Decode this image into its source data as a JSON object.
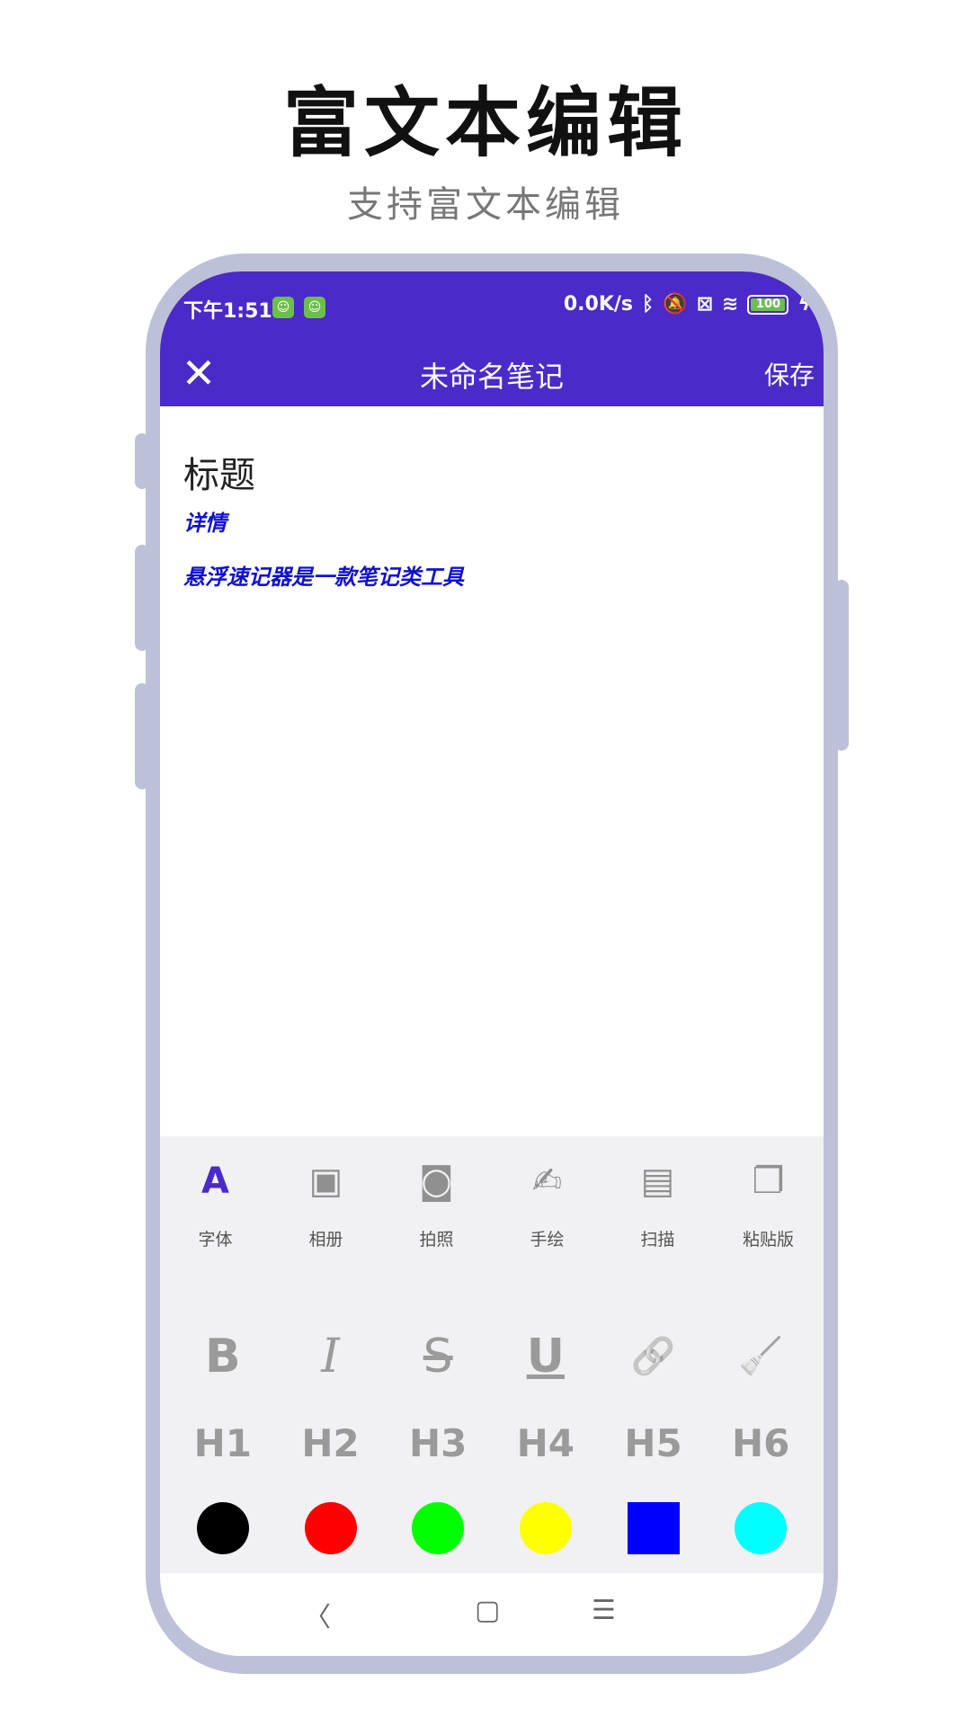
{
  "promo": {
    "title": "富文本编辑",
    "subtitle": "支持富文本编辑"
  },
  "status_bar": {
    "time": "下午1:51",
    "net_speed": "0.0K/s",
    "battery_level": "100",
    "icons": [
      "app-notification-icon",
      "app-notification-icon",
      "bluetooth-icon",
      "mute-vibrate-icon",
      "sim-off-icon",
      "wifi-icon",
      "battery-icon",
      "charging-icon"
    ]
  },
  "toolbar": {
    "close_icon": "close-icon",
    "title": "未命名笔记",
    "save_label": "保存"
  },
  "editor": {
    "title": "标题",
    "lines": [
      "详情",
      "悬浮速记器是一款笔记类工具"
    ],
    "text_color": "#1010d0"
  },
  "tools": [
    {
      "label": "字体",
      "icon": "font-icon",
      "active": true
    },
    {
      "label": "相册",
      "icon": "image-icon",
      "active": false
    },
    {
      "label": "拍照",
      "icon": "camera-icon",
      "active": false
    },
    {
      "label": "手绘",
      "icon": "handwriting-icon",
      "active": false
    },
    {
      "label": "扫描",
      "icon": "document-icon",
      "active": false
    },
    {
      "label": "粘贴版",
      "icon": "copy-icon",
      "active": false
    }
  ],
  "format_styles": [
    {
      "glyph": "B",
      "icon": "bold-icon"
    },
    {
      "glyph": "I",
      "icon": "italic-icon"
    },
    {
      "glyph": "S",
      "icon": "strikethrough-icon"
    },
    {
      "glyph": "U",
      "icon": "underline-icon"
    },
    {
      "glyph": "🔗",
      "icon": "link-icon"
    },
    {
      "glyph": "🧹",
      "icon": "clear-format-icon"
    }
  ],
  "headings": [
    "H1",
    "H2",
    "H3",
    "H4",
    "H5",
    "H6"
  ],
  "colors": [
    "#000000",
    "#ff0000",
    "#00ff00",
    "#ffff00",
    "#0000ff",
    "#00ffff"
  ],
  "accent_color": "#4a2ac8",
  "navbar": {
    "back_icon": "back-icon",
    "home_icon": "home-icon",
    "menu_icon": "menu-icon"
  }
}
